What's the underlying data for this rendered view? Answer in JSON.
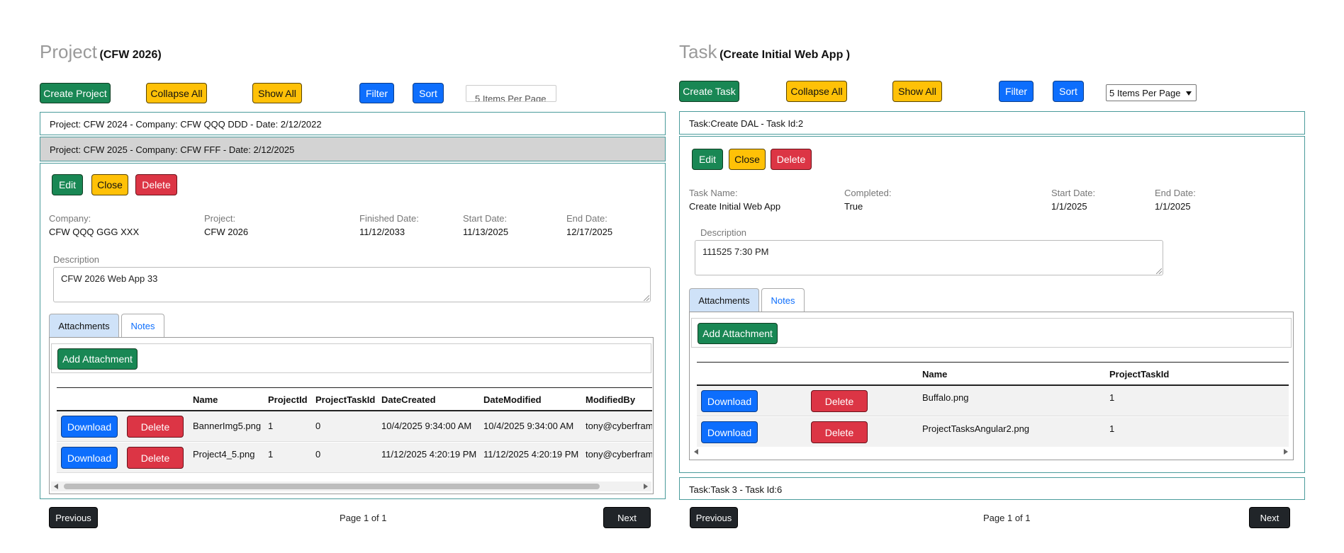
{
  "project": {
    "title": "Project",
    "subtitle": "(CFW 2026)",
    "toolbar": {
      "create_label": "Create Project",
      "collapse_label": "Collapse All",
      "show_label": "Show All",
      "filter_label": "Filter",
      "sort_label": "Sort",
      "per_page": "5 Items Per Page"
    },
    "rows": [
      "Project: CFW 2024 - Company: CFW QQQ DDD - Date: 2/12/2022",
      "Project: CFW 2025 - Company: CFW FFF - Date: 2/12/2025"
    ],
    "detail": {
      "edit_label": "Edit",
      "close_label": "Close",
      "delete_label": "Delete",
      "fields": [
        {
          "label": "Company:",
          "value": "CFW QQQ GGG XXX"
        },
        {
          "label": "Project:",
          "value": "CFW 2026"
        },
        {
          "label": "Finished Date:",
          "value": "11/12/2033"
        },
        {
          "label": "Start Date:",
          "value": "11/13/2025"
        },
        {
          "label": "End Date:",
          "value": "12/17/2025"
        }
      ],
      "description_label": "Description",
      "description_value": "CFW 2026 Web App 33",
      "tabs": [
        "Attachments",
        "Notes"
      ],
      "add_attachment_label": "Add Attachment",
      "columns": [
        "Name",
        "ProjectId",
        "ProjectTaskId",
        "DateCreated",
        "DateModified",
        "ModifiedBy"
      ],
      "attachments": [
        {
          "name": "BannerImg5.png",
          "project_id": "1",
          "project_task_id": "0",
          "date_created": "10/4/2025 9:34:00 AM",
          "date_modified": "10/4/2025 9:34:00 AM",
          "modified_by": "tony@cyberframe"
        },
        {
          "name": "Project4_5.png",
          "project_id": "1",
          "project_task_id": "0",
          "date_created": "11/12/2025 4:20:19 PM",
          "date_modified": "11/12/2025 4:20:19 PM",
          "modified_by": "tony@cyberframe"
        }
      ],
      "download_label": "Download",
      "row_delete_label": "Delete"
    },
    "pager": {
      "previous": "Previous",
      "page_text": "Page 1 of 1",
      "next": "Next"
    }
  },
  "task": {
    "title": "Task",
    "subtitle": "(Create Initial Web App )",
    "toolbar": {
      "create_label": "Create Task",
      "collapse_label": "Collapse All",
      "show_label": "Show All",
      "filter_label": "Filter",
      "sort_label": "Sort",
      "per_page": "5 Items Per Page"
    },
    "rows": [
      "Task:Create DAL - Task Id:2",
      "Task:Task 3 - Task Id:6"
    ],
    "detail": {
      "edit_label": "Edit",
      "close_label": "Close",
      "delete_label": "Delete",
      "fields": [
        {
          "label": "Task Name:",
          "value": "Create Initial Web App"
        },
        {
          "label": "Completed:",
          "value": "True"
        },
        {
          "label": "Start Date:",
          "value": "1/1/2025"
        },
        {
          "label": "End Date:",
          "value": "1/1/2025"
        }
      ],
      "description_label": "Description",
      "description_value": "111525 7:30 PM",
      "tabs": [
        "Attachments",
        "Notes"
      ],
      "add_attachment_label": "Add Attachment",
      "columns": [
        "Name",
        "ProjectTaskId"
      ],
      "attachments": [
        {
          "name": "Buffalo.png",
          "project_task_id": "1"
        },
        {
          "name": "ProjectTasksAngular2.png",
          "project_task_id": "1"
        }
      ],
      "download_label": "Download",
      "row_delete_label": "Delete"
    },
    "pager": {
      "previous": "Previous",
      "page_text": "Page 1 of 1",
      "next": "Next"
    }
  },
  "colors": {
    "green": "#198754",
    "yellow": "#ffc107",
    "blue": "#0d6efd",
    "red": "#dc3545",
    "dark": "#212529",
    "border_teal": "#4a9b9b",
    "selected_row": "#d3d3d3"
  }
}
